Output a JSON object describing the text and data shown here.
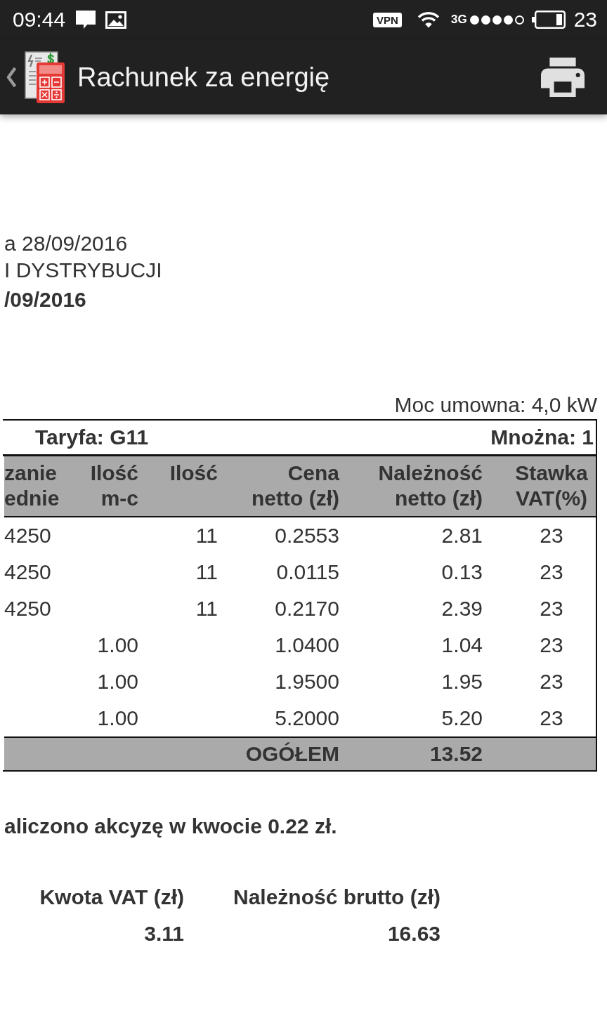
{
  "status_bar": {
    "time": "09:44",
    "vpn": "VPN",
    "network": "3G",
    "battery": "23"
  },
  "app_bar": {
    "title": "Rachunek za energię"
  },
  "header_lines": [
    {
      "text": "a 28/09/2016",
      "bold": false
    },
    {
      "text": "I DYSTRYBUCJI",
      "bold": false
    },
    {
      "text": "/09/2016",
      "bold": true
    }
  ],
  "contract_power": "Moc umowna: 4,0 kW",
  "table": {
    "tariff": "Taryfa: G11",
    "multiplier": "Mnożna: 1",
    "columns": [
      {
        "heading": [
          "zanie",
          "ednie"
        ]
      },
      {
        "heading": [
          "Ilość",
          "m-c"
        ]
      },
      {
        "heading": [
          "Ilość"
        ]
      },
      {
        "heading": [
          "Cena",
          "netto (zł)"
        ]
      },
      {
        "heading": [
          "Należność",
          "netto (zł)"
        ]
      },
      {
        "heading": [
          "Stawka",
          "VAT(%)"
        ]
      }
    ],
    "rows": [
      {
        "column_1": "4250",
        "quantity": "11",
        "net_price": "0.2553",
        "net_amount": "2.81",
        "vat_rate": "23"
      },
      {
        "column_1": "4250",
        "quantity": "11",
        "net_price": "0.0115",
        "net_amount": "0.13",
        "vat_rate": "23"
      },
      {
        "column_1": "4250",
        "quantity": "11",
        "net_price": "0.2170",
        "net_amount": "2.39",
        "vat_rate": "23"
      },
      {
        "quantity_mc": "1.00",
        "net_price": "1.0400",
        "net_amount": "1.04",
        "vat_rate": "23"
      },
      {
        "quantity_mc": "1.00",
        "net_price": "1.9500",
        "net_amount": "1.95",
        "vat_rate": "23"
      },
      {
        "quantity_mc": "1.00",
        "net_price": "5.2000",
        "net_amount": "5.20",
        "vat_rate": "23"
      }
    ],
    "total": {
      "label": "OGÓŁEM",
      "value": "13.52"
    }
  },
  "excise_note": "aliczono akcyzę w kwocie 0.22 zł.",
  "summary": [
    {
      "label": "Kwota VAT (zł)",
      "value": "3.11"
    },
    {
      "label": "Należność brutto (zł)",
      "value": "16.63"
    }
  ]
}
